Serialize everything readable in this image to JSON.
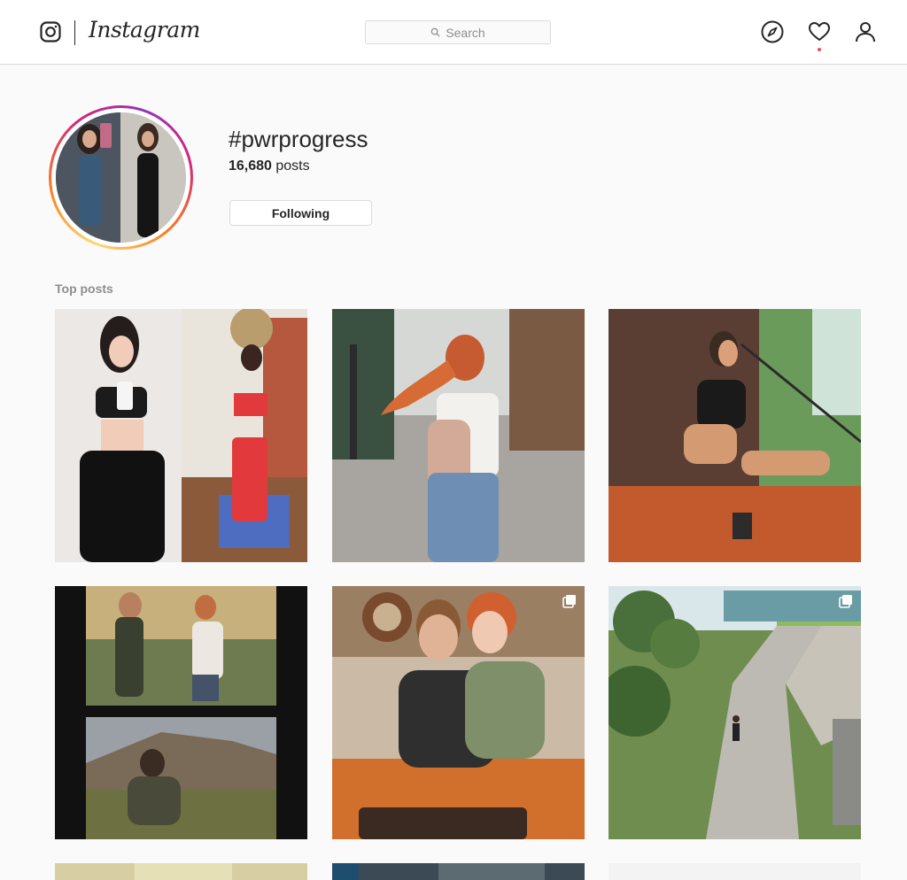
{
  "header": {
    "brand": "Instagram",
    "search_placeholder": "Search",
    "icons": [
      "camera-logo-icon",
      "compass-icon",
      "heart-icon",
      "profile-icon"
    ],
    "has_notification": true
  },
  "profile": {
    "hashtag": "#pwrprogress",
    "post_count": "16,680",
    "post_count_suffix": " posts",
    "follow_label": "Following"
  },
  "top_posts": {
    "label": "Top posts",
    "posts": [
      {
        "multi": false
      },
      {
        "multi": false
      },
      {
        "multi": false
      },
      {
        "multi": false
      },
      {
        "multi": true
      },
      {
        "multi": true
      },
      {
        "multi": false
      },
      {
        "multi": false
      },
      {
        "multi": false
      }
    ]
  },
  "colors": {
    "accent_ring_start": "#feda75",
    "accent_ring_end": "#962fbf",
    "notification": "#ed4956",
    "text": "#262626",
    "muted": "#8e8e8e",
    "border": "#dbdbdb"
  }
}
